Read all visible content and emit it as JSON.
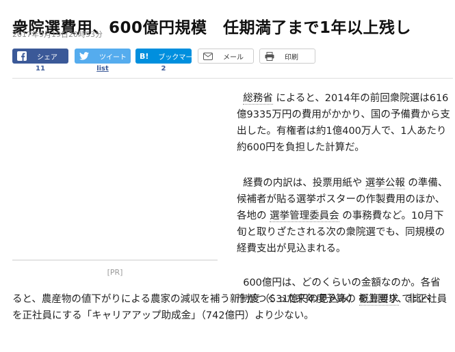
{
  "article": {
    "headline": "衆院選費用、600億円規模　任期満了まで1年以上残し",
    "dateline": "2017年9月19日20時53分"
  },
  "share": {
    "facebook": {
      "label": "シェア",
      "count": "11"
    },
    "twitter": {
      "label": "ツイート",
      "count": "list"
    },
    "hatena": {
      "label": "ブックマーク",
      "count": "2",
      "logo": "B!"
    },
    "mail": {
      "label": "メール"
    },
    "print": {
      "label": "印刷"
    }
  },
  "ad": {
    "label": "[PR]"
  },
  "body": {
    "p1": {
      "kw1": "総務省",
      "t1": " によると、2014年の前回衆院選は616億9335万円の費用がかかり、国の予備費から支出した。有権者は約1億400万人で、1人あたり約600円を負担した計算だ。"
    },
    "p2": {
      "t1": "経費の内訳は、投票用紙や ",
      "kw1": "選挙公報",
      "t2": " の準備、候補者が貼る選挙ポスターの作製費用のほか、各地の ",
      "kw2": "選挙管理委員会",
      "t3": " の事務費など。10月下旬と取りざたされる次の衆院選でも、同規模の経費支出が見込まれる。"
    },
    "p3": {
      "t1": "600億円は、どのくらいの金額なのか。各省庁がつくった来年度予算の ",
      "kw1": "概算要求",
      "t2": " で比べ",
      "t3": "ると、農産物の値下がりによる農家の減収を補う新制度（531億円の見込み）を上回り、非正社員を正社員にする「キャリアアップ助成金」（742億円）より少ない。"
    }
  }
}
